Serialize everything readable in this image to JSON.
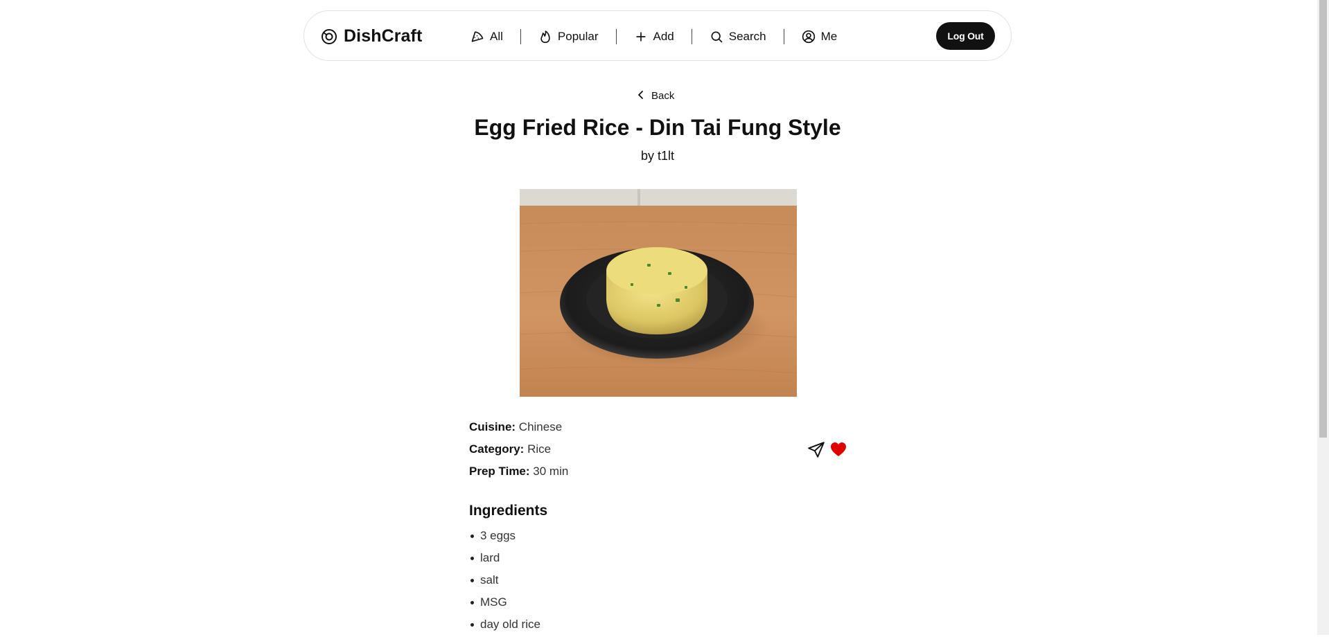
{
  "navbar": {
    "brand": "DishCraft",
    "items": [
      {
        "label": "All",
        "icon": "pizza-slice-icon"
      },
      {
        "label": "Popular",
        "icon": "flame-icon"
      },
      {
        "label": "Add",
        "icon": "plus-icon"
      },
      {
        "label": "Search",
        "icon": "search-icon"
      },
      {
        "label": "Me",
        "icon": "user-circle-icon"
      }
    ],
    "logout_label": "Log Out"
  },
  "recipe": {
    "back_label": "Back",
    "title": "Egg Fried Rice - Din Tai Fung Style",
    "author": "by t1lt",
    "image_alt": "Egg fried rice on a black plate",
    "cuisine_label": "Cuisine:",
    "cuisine": "Chinese",
    "category_label": "Category:",
    "category": "Rice",
    "prep_label": "Prep Time:",
    "prep_time": "30 min",
    "ingredients_heading": "Ingredients",
    "ingredients": [
      "3 eggs",
      "lard",
      "salt",
      "MSG",
      "day old rice"
    ]
  },
  "colors": {
    "accent": "#111111",
    "heart": "#e00000"
  }
}
